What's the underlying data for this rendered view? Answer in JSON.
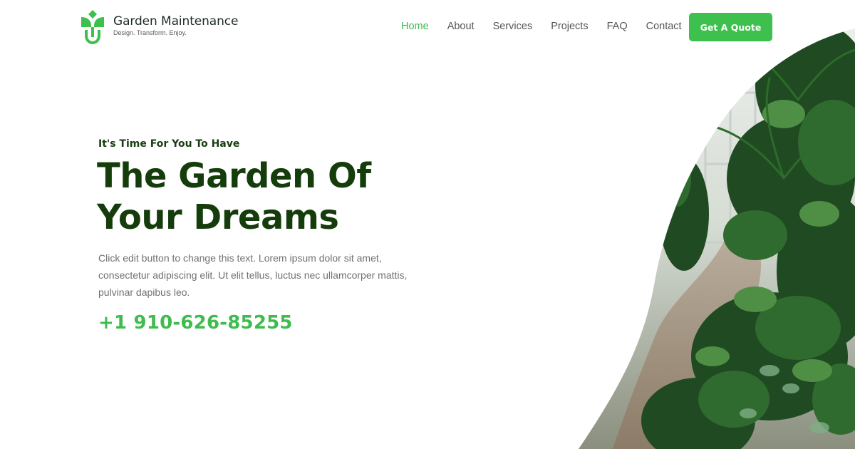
{
  "brand": {
    "name": "Garden Maintenance",
    "tagline": "Design. Transform. Enjoy."
  },
  "nav": {
    "items": [
      {
        "label": "Home",
        "active": true
      },
      {
        "label": "About",
        "active": false
      },
      {
        "label": "Services",
        "active": false
      },
      {
        "label": "Projects",
        "active": false
      },
      {
        "label": "FAQ",
        "active": false
      },
      {
        "label": "Contact",
        "active": false
      }
    ],
    "cta_label": "Get A Quote"
  },
  "hero": {
    "eyebrow": "It's Time For You To Have",
    "headline_line1": "The Garden Of",
    "headline_line2": "Your Dreams",
    "lead_line1": "Click edit button to change this text. Lorem ipsum dolor sit amet,",
    "lead_line2": "consectetur adipiscing elit. Ut elit tellus, luctus nec ullamcorper mattis,",
    "lead_line3": "pulvinar dapibus leo.",
    "phone": "+1 910-626-85255"
  },
  "colors": {
    "accent": "#3ec04f",
    "heading": "#153d0c",
    "text": "#707070"
  },
  "icons": {
    "logo": "leaf-shovel-icon"
  }
}
